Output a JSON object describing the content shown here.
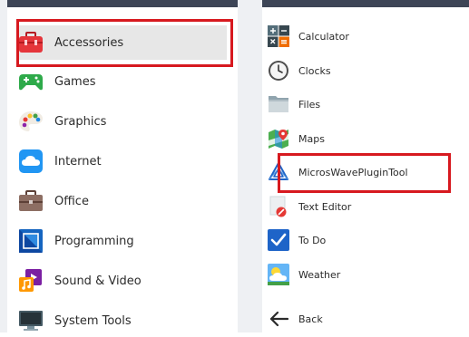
{
  "left_menu": {
    "items": [
      {
        "label": "Accessories",
        "icon": "toolbox-icon",
        "selected": true
      },
      {
        "label": "Games",
        "icon": "gamepad-icon"
      },
      {
        "label": "Graphics",
        "icon": "palette-icon"
      },
      {
        "label": "Internet",
        "icon": "cloud-icon"
      },
      {
        "label": "Office",
        "icon": "briefcase-icon"
      },
      {
        "label": "Programming",
        "icon": "code-icon"
      },
      {
        "label": "Sound & Video",
        "icon": "music-icon"
      },
      {
        "label": "System Tools",
        "icon": "monitor-icon"
      }
    ]
  },
  "right_menu": {
    "items": [
      {
        "label": "Calculator",
        "icon": "calculator-icon"
      },
      {
        "label": "Clocks",
        "icon": "clock-icon"
      },
      {
        "label": "Files",
        "icon": "folder-icon"
      },
      {
        "label": "Maps",
        "icon": "map-icon"
      },
      {
        "label": "MicrosWavePluginTool",
        "icon": "triangle-logo-icon",
        "highlighted": true
      },
      {
        "label": "Text Editor",
        "icon": "text-editor-icon"
      },
      {
        "label": "To Do",
        "icon": "checkbox-icon"
      },
      {
        "label": "Weather",
        "icon": "weather-icon"
      }
    ],
    "back_label": "Back"
  },
  "colors": {
    "highlight": "#d7191f",
    "selected_background": "#e7e7e7"
  }
}
